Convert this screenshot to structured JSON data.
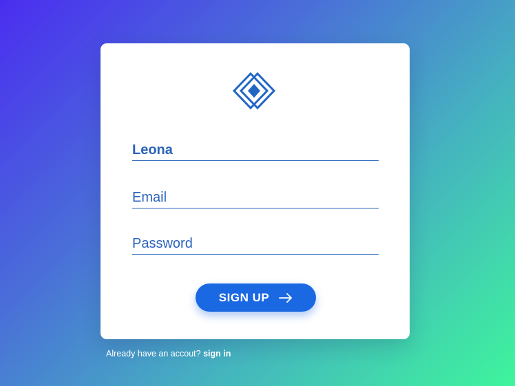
{
  "form": {
    "name_value": "Leona",
    "email_placeholder": "Email",
    "password_placeholder": "Password",
    "submit_label": "SIGN UP",
    "submit_icon": "arrow-right-icon"
  },
  "footer": {
    "prompt_text": "Already have an accout?",
    "signin_link": "sign in"
  },
  "logo": {
    "icon": "diamond-logo-icon"
  },
  "colors": {
    "accent": "#1a68e2",
    "field_text": "#2a63b9",
    "underline": "#2160b8",
    "gradient_start": "#4a2df0",
    "gradient_end": "#3ef59c"
  }
}
